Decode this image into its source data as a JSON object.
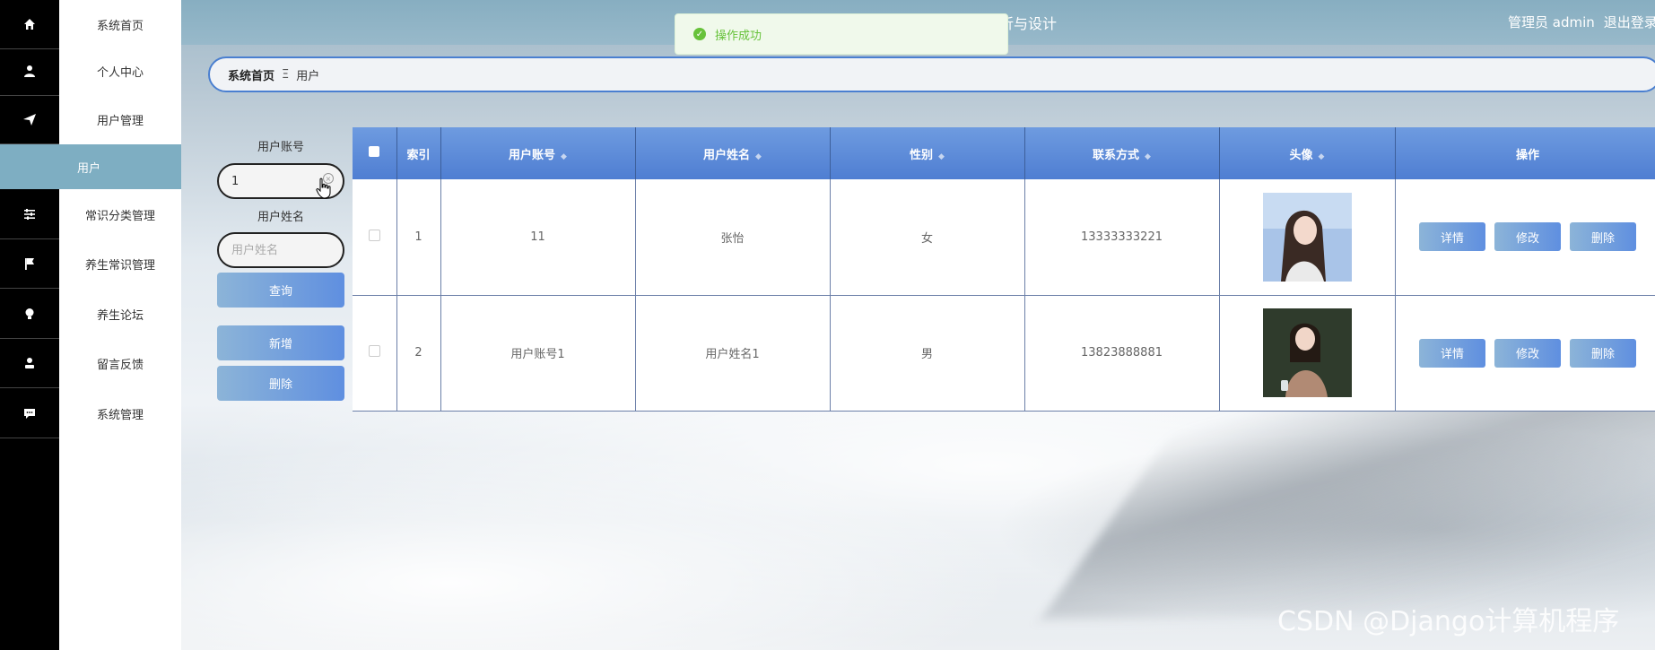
{
  "header": {
    "title_fragment": "折与设计",
    "user_text": "管理员 admin",
    "logout": "退出登录"
  },
  "toast": {
    "message": "操作成功"
  },
  "sidebar": {
    "items": [
      {
        "label": "系统首页",
        "icon": "home-icon"
      },
      {
        "label": "个人中心",
        "icon": "user-icon"
      },
      {
        "label": "用户管理",
        "icon": "send-icon"
      },
      {
        "label": "常识分类管理",
        "icon": "sliders-icon"
      },
      {
        "label": "养生常识管理",
        "icon": "flag-icon"
      },
      {
        "label": "养生论坛",
        "icon": "bulb-icon"
      },
      {
        "label": "留言反馈",
        "icon": "person-icon"
      },
      {
        "label": "系统管理",
        "icon": "chat-icon"
      }
    ],
    "active_sub": "用户"
  },
  "breadcrumb": {
    "home": "系统首页",
    "separator": "Ξ",
    "current": "用户"
  },
  "search": {
    "account_label": "用户账号",
    "account_value": "1",
    "name_label": "用户姓名",
    "name_placeholder": "用户姓名",
    "query_button": "查询",
    "add_button": "新增",
    "delete_button": "删除"
  },
  "table": {
    "headers": [
      "索引",
      "用户账号",
      "用户姓名",
      "性别",
      "联系方式",
      "头像",
      "操作"
    ],
    "rows": [
      {
        "index": "1",
        "account": "11",
        "name": "张怡",
        "gender": "女",
        "phone": "13333333221"
      },
      {
        "index": "2",
        "account": "用户账号1",
        "name": "用户姓名1",
        "gender": "男",
        "phone": "13823888881"
      }
    ],
    "actions": {
      "detail": "详情",
      "edit": "修改",
      "delete": "删除"
    }
  },
  "watermark": "CSDN @Django计算机程序",
  "colors": {
    "header_bg": "#8fb3c6",
    "active_nav": "#7eaec2",
    "table_head": "#5a88d6",
    "button": "#6f9fdc",
    "toast_text": "#67c23a"
  }
}
